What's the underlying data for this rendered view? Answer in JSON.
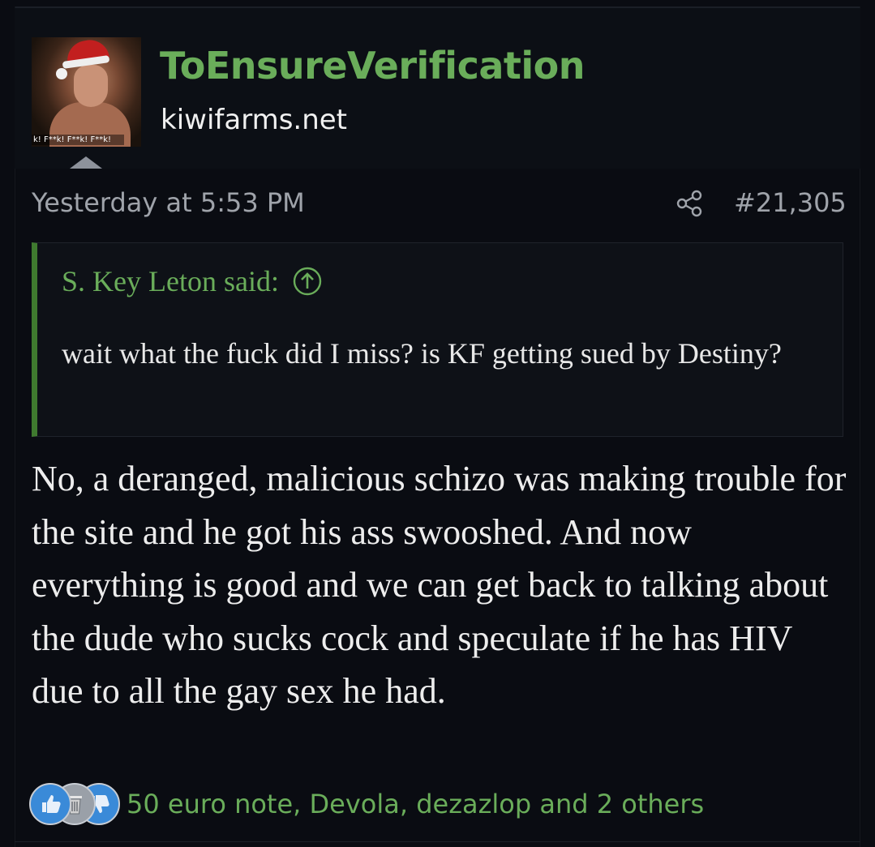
{
  "user": {
    "username": "ToEnsureVerification",
    "site": "kiwifarms.net",
    "avatar_caption": "k! F**k! F**k! F**k!"
  },
  "post": {
    "timestamp": "Yesterday at 5:53 PM",
    "number": "#21,305",
    "quote": {
      "attribution": "S. Key Leton said:",
      "text": "wait what the fuck did I miss? is KF getting sued by Destiny?"
    },
    "body": "No, a deranged, malicious schizo was making trouble for the site and he got his ass swooshed. And now everything is good and we can get back to talking about the dude who sucks cock and speculate if he has HIV due to all the gay sex he had.",
    "reactions": {
      "icons": [
        "thumbs-up-icon",
        "trash-can-icon",
        "thumbs-down-icon"
      ],
      "names": "50 euro note, Devola, dezazlop and 2 others"
    }
  },
  "colors": {
    "background": "#0a0c12",
    "username": "#6aad5a",
    "quote_border": "#3f7a2f",
    "meta_text": "#9fa3aa",
    "reaction_blue": "#3a8ad8"
  }
}
